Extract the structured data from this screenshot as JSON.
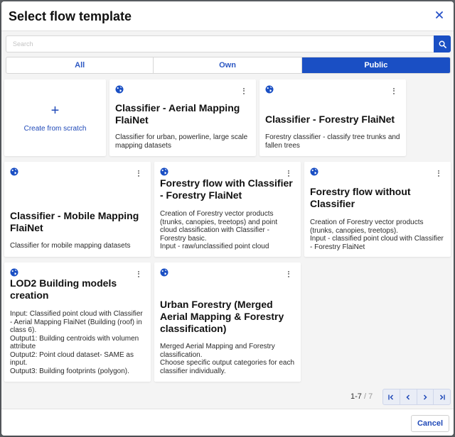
{
  "dialog": {
    "title": "Select flow template",
    "close_icon": "close-icon"
  },
  "search": {
    "placeholder": "Search",
    "value": "",
    "icon": "search-icon"
  },
  "tabs": [
    {
      "label": "All",
      "active": false
    },
    {
      "label": "Own",
      "active": false
    },
    {
      "label": "Public",
      "active": true
    }
  ],
  "create_card": {
    "icon": "plus-icon",
    "label": "Create from scratch"
  },
  "cards": [
    {
      "title": "Classifier - Aerial Mapping\nFlaiNet",
      "description": "Classifier for urban, powerline, large scale mapping datasets",
      "icon": "globe-icon"
    },
    {
      "title": "Classifier - Forestry FlaiNet",
      "description": "Forestry classifier - classify tree trunks and fallen trees",
      "icon": "globe-icon"
    },
    {
      "title": "Classifier - Mobile Mapping\nFlaiNet",
      "description": "Classifier for mobile mapping datasets",
      "icon": "globe-icon"
    },
    {
      "title": "Forestry flow with Classifier\n- Forestry FlaiNet",
      "description": "Creation of Forestry vector products (trunks, canopies, treetops) and point cloud classification with Classifier - Forestry basic.\nInput - raw/unclassified point cloud",
      "icon": "globe-icon"
    },
    {
      "title": "Forestry flow without\nClassifier",
      "description": "Creation of Forestry vector products (trunks, canopies, treetops).\nInput - classified point cloud with Classifier - Forestry FlaiNet",
      "icon": "globe-icon"
    },
    {
      "title": "LOD2 Building models\ncreation",
      "description": "Input: Classified point cloud with Classifier - Aerial Mapping FlaiNet (Building (roof) in class 6).\nOutput1: Building centroids with volumen attribute\nOutput2: Point cloud dataset- SAME as input.\nOutput3: Building footprints (polygon).",
      "icon": "globe-icon"
    },
    {
      "title": "Urban Forestry (Merged\nAerial Mapping & Forestry\nclassification)",
      "description": "Merged Aerial Mapping and Forestry classification.\nChoose specific output categories for each classifier individually.",
      "icon": "globe-icon"
    }
  ],
  "pagination": {
    "range": "1-7",
    "separator": " / ",
    "total": "7",
    "buttons": [
      "first-page-icon",
      "previous-page-icon",
      "next-page-icon",
      "last-page-icon"
    ]
  },
  "footer": {
    "cancel_label": "Cancel"
  },
  "colors": {
    "accent": "#1a4fc4",
    "link": "#1f49b8",
    "background": "#f4f4f4"
  }
}
